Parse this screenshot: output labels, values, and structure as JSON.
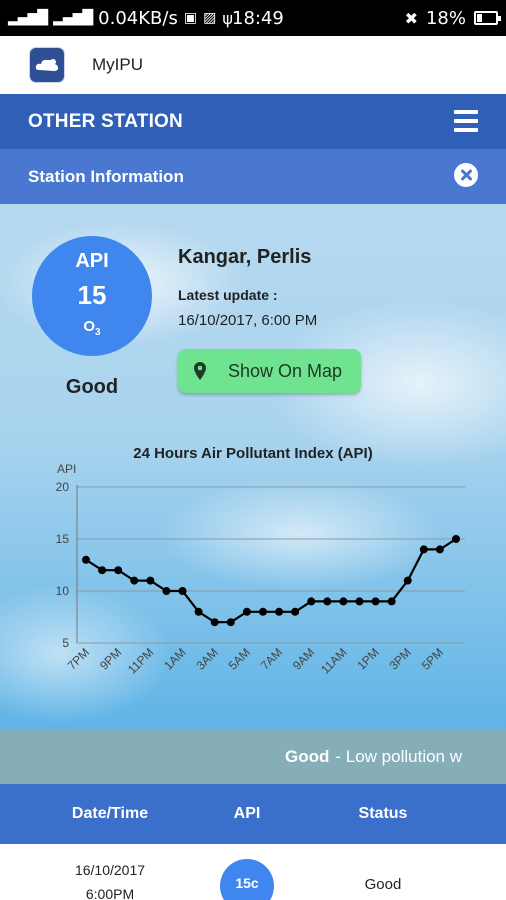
{
  "status_bar": {
    "left_text": "0.04KB/s",
    "time": "18:49",
    "battery": "18%"
  },
  "app": {
    "title": "MyIPU"
  },
  "nav": {
    "title": "OTHER STATION",
    "subtitle": "Station Information"
  },
  "station": {
    "api_label": "API",
    "api_value": "15",
    "pollutant": "O",
    "pollutant_sub": "3",
    "status": "Good",
    "name": "Kangar, Perlis",
    "update_label": "Latest update :",
    "update_value": "16/10/2017, 6:00 PM",
    "map_button": "Show On Map"
  },
  "ticker": {
    "bold": "Good",
    "text": "- Low pollution w"
  },
  "table": {
    "headers": [
      "Date/Time",
      "API",
      "Status"
    ],
    "rows": [
      {
        "date": "16/10/2017",
        "time": "6:00PM",
        "api": "15c",
        "status": "Good"
      }
    ]
  },
  "colors": {
    "nav": "#2f5fb7",
    "sub_nav": "#4a78d0",
    "api_circle": "#3f86ee",
    "map_button": "#6fe38f",
    "ticker": "#86aeb9"
  },
  "chart_data": {
    "type": "line",
    "title": "24 Hours Air Pollutant Index (API)",
    "ylabel": "API",
    "xlabel": "",
    "ylim": [
      5,
      20
    ],
    "yticks": [
      5,
      10,
      15,
      20
    ],
    "grid": true,
    "x_tick_labels": [
      "7PM",
      "9PM",
      "11PM",
      "1AM",
      "3AM",
      "5AM",
      "7AM",
      "9AM",
      "11AM",
      "1PM",
      "3PM",
      "5PM"
    ],
    "x": [
      "7PM",
      "8PM",
      "9PM",
      "10PM",
      "11PM",
      "12AM",
      "1AM",
      "2AM",
      "3AM",
      "4AM",
      "5AM",
      "6AM",
      "7AM",
      "8AM",
      "9AM",
      "10AM",
      "11AM",
      "12PM",
      "1PM",
      "2PM",
      "3PM",
      "4PM",
      "5PM",
      "6PM"
    ],
    "values": [
      13,
      12,
      12,
      11,
      11,
      10,
      10,
      8,
      7,
      7,
      8,
      8,
      8,
      8,
      9,
      9,
      9,
      9,
      9,
      9,
      11,
      14,
      14,
      15
    ]
  }
}
